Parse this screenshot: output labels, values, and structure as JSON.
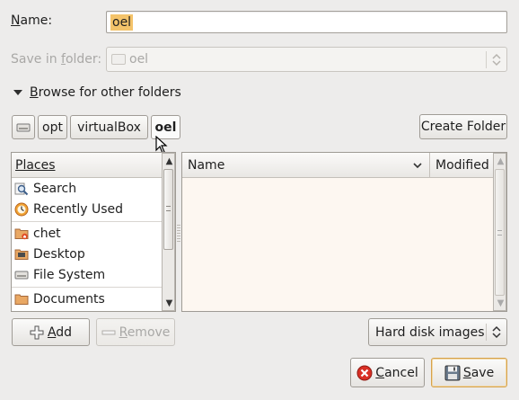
{
  "name_label": "Name:",
  "name_value": "oel",
  "save_in_label": "Save in folder:",
  "save_in_value": "oel",
  "browse_label": "Browse for other folders",
  "path_buttons": [
    "opt",
    "virtualBox",
    "oel"
  ],
  "create_folder": "Create Folder",
  "places_header": "Places",
  "places": [
    {
      "label": "Search",
      "icon": "search-icon"
    },
    {
      "label": "Recently Used",
      "icon": "recent-icon"
    },
    {
      "label": "chet",
      "icon": "home-folder-icon"
    },
    {
      "label": "Desktop",
      "icon": "desktop-icon"
    },
    {
      "label": "File System",
      "icon": "drive-icon"
    },
    {
      "label": "Documents",
      "icon": "folder-icon"
    }
  ],
  "files_header": {
    "name": "Name",
    "modified": "Modified"
  },
  "add_label": "Add",
  "remove_label": "Remove",
  "filter_value": "Hard disk images",
  "cancel_label": "Cancel",
  "save_label": "Save",
  "colors": {
    "selection": "#f4c36a",
    "accent_focus": "#d6a24c"
  }
}
